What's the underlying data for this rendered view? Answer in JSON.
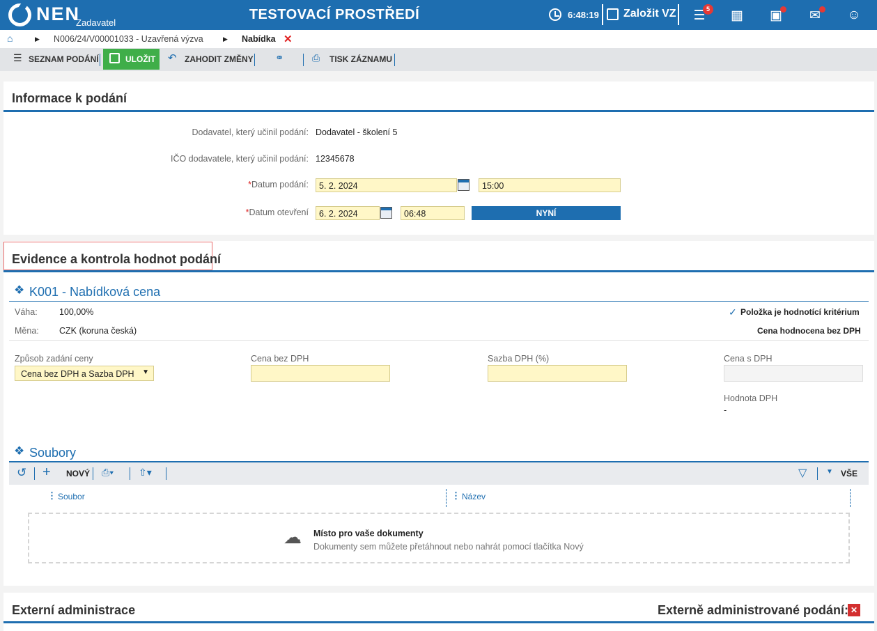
{
  "header": {
    "logo": "NEN",
    "role": "Zadavatel",
    "environment": "TESTOVACÍ PROSTŘEDÍ",
    "time": "6:48:19",
    "create_label": "Založit VZ",
    "tasks_badge": "5"
  },
  "breadcrumb": {
    "item1": "N006/24/V00001033 - Uzavřená výzva",
    "item2": "Nabídka"
  },
  "toolbar": {
    "list": "SEZNAM PODÁNÍ",
    "save": "ULOŽIT",
    "discard": "ZAHODIT ZMĚNY",
    "print": "TISK ZÁZNAMU"
  },
  "info": {
    "title": "Informace k podání",
    "supplier_label": "Dodavatel, který učinil podání:",
    "supplier_value": "Dodavatel - školení 5",
    "ico_label": "IČO dodavatele, který učinil podání:",
    "ico_value": "12345678",
    "submit_label": "Datum podání:",
    "submit_date": "5. 2. 2024",
    "submit_time": "15:00",
    "open_label": "Datum otevření",
    "open_date": "6. 2. 2024",
    "open_time": "06:48",
    "now_label": "NYNÍ"
  },
  "evidence": {
    "title": "Evidence a kontrola hodnot podání",
    "criterion_title": "K001 - Nabídková cena",
    "weight_label": "Váha:",
    "weight_value": "100,00%",
    "currency_label": "Měna:",
    "currency_value": "CZK (koruna česká)",
    "criterion_flag": "Položka je hodnotící kritérium",
    "price_basis": "Cena hodnocena bez DPH",
    "mode_label": "Způsob zadání ceny",
    "mode_value": "Cena bez DPH a Sazba DPH",
    "price_label": "Cena bez DPH",
    "vat_rate_label": "Sazba DPH (%)",
    "price_vat_label": "Cena s DPH",
    "vat_value_label": "Hodnota DPH",
    "vat_value": "-"
  },
  "files": {
    "title": "Soubory",
    "new_label": "NOVÝ",
    "all_label": "VŠE",
    "col_file": "Soubor",
    "col_name": "Název",
    "drop_title": "Místo pro vaše dokumenty",
    "drop_hint": "Dokumenty sem můžete přetáhnout nebo nahrát pomocí tlačítka Nový"
  },
  "external": {
    "title": "Externí administrace",
    "flag_label": "Externě administrované podání:"
  }
}
